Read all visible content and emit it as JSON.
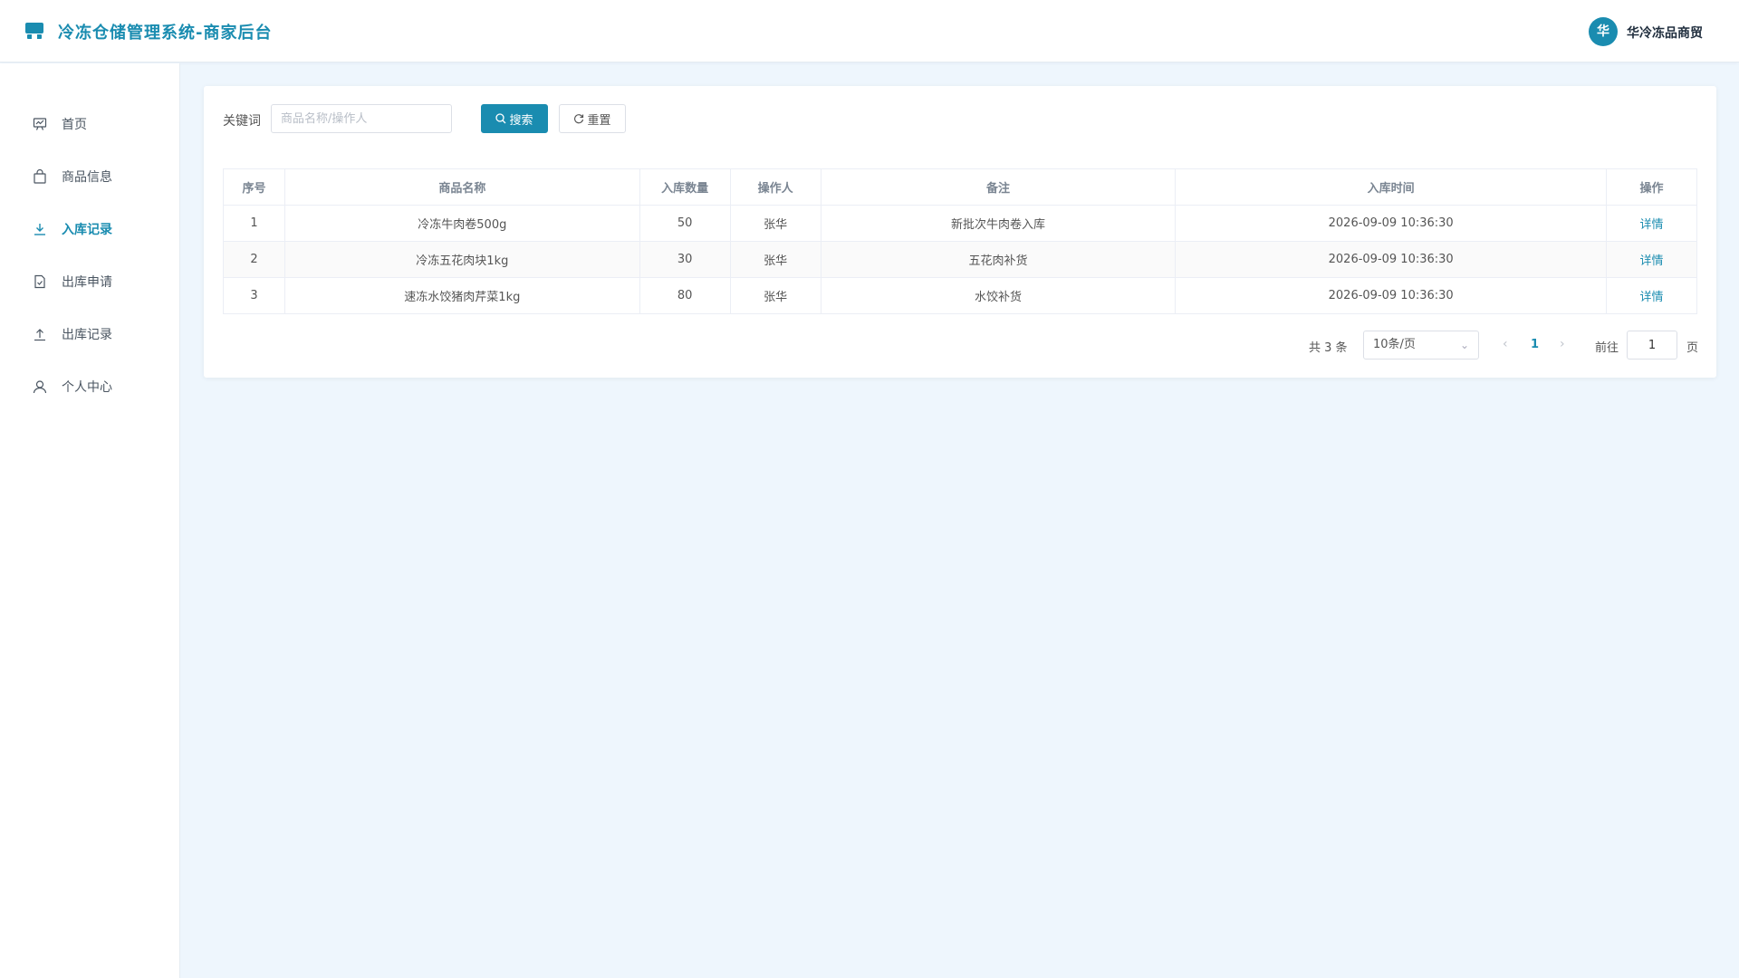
{
  "header": {
    "logo_icon": "store-icon",
    "title": "冷冻仓储管理系统-商家后台",
    "avatar_text": "华",
    "user_name": "华冷冻品商贸"
  },
  "sidebar": {
    "items": [
      {
        "label": "首页",
        "icon": "dashboard-icon",
        "active": false
      },
      {
        "label": "商品信息",
        "icon": "shopping-bag-icon",
        "active": false
      },
      {
        "label": "入库记录",
        "icon": "download-icon",
        "active": true
      },
      {
        "label": "出库申请",
        "icon": "document-check-icon",
        "active": false
      },
      {
        "label": "出库记录",
        "icon": "upload-icon",
        "active": false
      },
      {
        "label": "个人中心",
        "icon": "user-icon",
        "active": false
      }
    ]
  },
  "search": {
    "label": "关键词",
    "placeholder": "商品名称/操作人",
    "value": "",
    "search_button": "搜索",
    "reset_button": "重置"
  },
  "table": {
    "columns": [
      "序号",
      "商品名称",
      "入库数量",
      "操作人",
      "备注",
      "入库时间",
      "操作"
    ],
    "rows": [
      {
        "index": "1",
        "name": "冷冻牛肉卷500g",
        "quantity": "50",
        "operator": "张华",
        "note": "新批次牛肉卷入库",
        "time": "2026-09-09 10:36:30",
        "action": "详情"
      },
      {
        "index": "2",
        "name": "冷冻五花肉块1kg",
        "quantity": "30",
        "operator": "张华",
        "note": "五花肉补货",
        "time": "2026-09-09 10:36:30",
        "action": "详情"
      },
      {
        "index": "3",
        "name": "速冻水饺猪肉芹菜1kg",
        "quantity": "80",
        "operator": "张华",
        "note": "水饺补货",
        "time": "2026-09-09 10:36:30",
        "action": "详情"
      }
    ]
  },
  "pagination": {
    "total_text": "共 3 条",
    "page_size": "10条/页",
    "current_page": "1",
    "goto_label": "前往",
    "goto_value": "1",
    "page_suffix": "页"
  },
  "colors": {
    "accent": "#1a8cb0",
    "background": "#eef6fd"
  }
}
